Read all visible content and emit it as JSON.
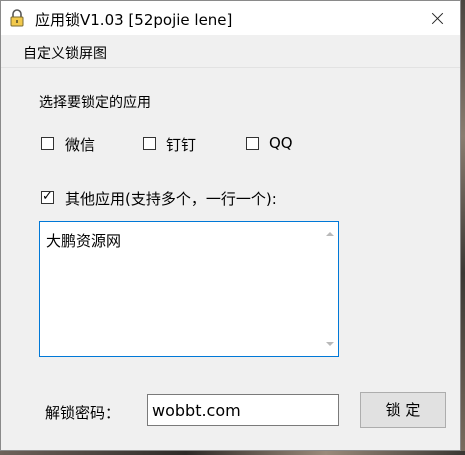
{
  "window": {
    "title": "应用锁V1.03 [52pojie lene]"
  },
  "menu": {
    "custom_lock_screen": "自定义锁屏图"
  },
  "main": {
    "select_label": "选择要锁定的应用",
    "apps": [
      {
        "label": "微信",
        "checked": false
      },
      {
        "label": "钉钉",
        "checked": false
      },
      {
        "label": "QQ",
        "checked": false
      }
    ],
    "other_apps": {
      "label": "其他应用(支持多个，一行一个):",
      "checked": true,
      "check_glyph": "✓",
      "value": "大鹏资源网"
    },
    "unlock_password_label": "解锁密码：",
    "unlock_password_value": "wobbt.com",
    "lock_button": "锁 定"
  },
  "colors": {
    "window_bg": "#f0f0f0",
    "titlebar_bg": "#ffffff",
    "focus_border": "#0078d7",
    "button_bg": "#e1e1e1"
  },
  "icons": {
    "app_icon": "lock-icon",
    "close_icon": "close-icon",
    "scroll_up": "chevron-up-icon",
    "scroll_down": "chevron-down-icon"
  }
}
